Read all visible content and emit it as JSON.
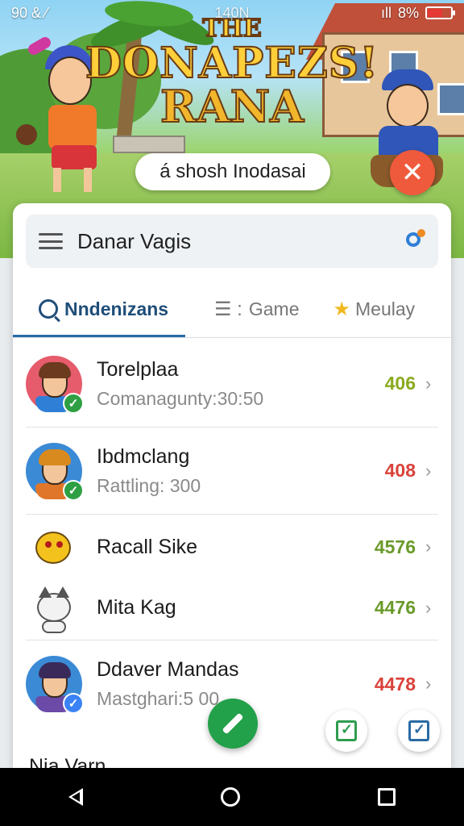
{
  "status_bar": {
    "left": "90 & ⁄",
    "center": "140N",
    "signal": "ıll",
    "battery": "8%"
  },
  "banner": {
    "title_line1": "THE",
    "title_line2": "DONAPEZS!",
    "title_line3": "RANA",
    "pill_text": "á shosh Inodasai",
    "close_glyph": "✕"
  },
  "header": {
    "title": "Danar Vagis"
  },
  "tabs": [
    {
      "label": "Nndenizans",
      "icon": "search-icon",
      "active": true
    },
    {
      "label": "Game",
      "prefix": "☰ :",
      "icon": "list-icon",
      "active": false
    },
    {
      "label": "Meulay",
      "icon": "star-icon",
      "active": false
    }
  ],
  "players": [
    {
      "name": "Torelplaa",
      "subtitle": "Comanagunty:30:50",
      "score": "406",
      "score_color": "#8aaa1e",
      "avatar_bg": "#e65c6c",
      "hair": "#6b3a1f",
      "shirt": "#2f7fd6",
      "badge": "green"
    },
    {
      "name": "Ibdmclang",
      "subtitle": "Rattling: 300",
      "score": "408",
      "score_color": "#d9423a",
      "avatar_bg": "#3b8ad6",
      "hair": "#d98a1f",
      "shirt": "#e0762a",
      "badge": "green"
    },
    {
      "name": "Racall Sike",
      "subtitle": "",
      "score": "4576",
      "score_color": "#6a9a2a",
      "sticker": "yellow-creature-icon"
    },
    {
      "name": "Mita Kag",
      "subtitle": "",
      "score": "4476",
      "score_color": "#6a9a2a",
      "sticker": "cat-icon"
    },
    {
      "name": "Ddaver Mandas",
      "subtitle": "Mastghari:5 00",
      "score": "4478",
      "score_color": "#d9423a",
      "avatar_bg": "#3b8ad6",
      "hair": "#3a2a5a",
      "shirt": "#6b4aa8",
      "badge": "blue"
    }
  ],
  "peek_text": "Nia Varn",
  "chevron": "›"
}
